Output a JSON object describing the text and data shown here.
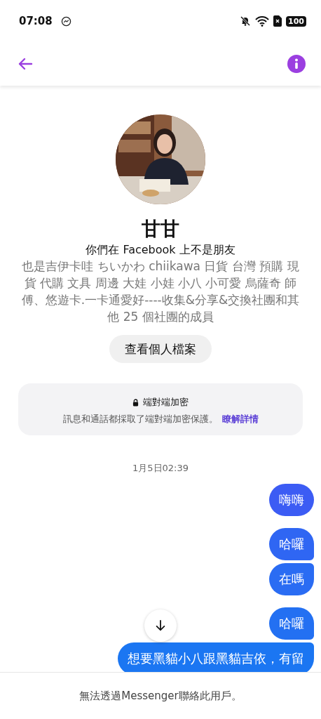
{
  "status_bar": {
    "time": "07:08",
    "battery": "100"
  },
  "profile": {
    "name": "甘甘",
    "relation": "你們在 Facebook 上不是朋友",
    "bio": "也是吉伊卡哇 ちいかわ chiikawa 日貨 台灣 預購 現貨 代購 文具 周邊 大娃 小娃 小八 小可愛 烏薩奇 師傅、悠遊卡.一卡通愛好----收集&分享&交換社團和其他 25 個社團的成員",
    "button": "查看個人檔案"
  },
  "encryption": {
    "title": "端對端加密",
    "text": "訊息和通話都採取了端對端加密保護。",
    "link": "瞭解詳情"
  },
  "timestamp": "1月5日02:39",
  "message_groups": [
    [
      {
        "text": "嗨嗨"
      }
    ],
    [
      {
        "text": "哈囉"
      },
      {
        "text": "在嗎"
      }
    ],
    [
      {
        "text": "哈囉"
      },
      {
        "text": "想要黑貓小八跟黑貓吉依，有留"
      }
    ]
  ],
  "footer": "無法透過Messenger聯絡此用戶。"
}
